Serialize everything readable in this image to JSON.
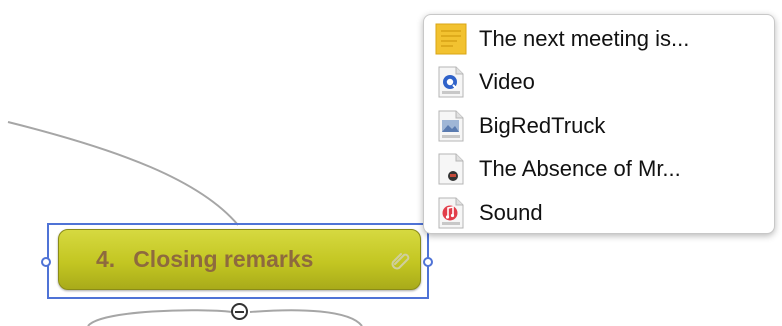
{
  "topic": {
    "number": "4.",
    "title": "Closing remarks",
    "attachment_icon": "paperclip-icon",
    "fill_color": "#c8cb28",
    "text_color": "#8e6a3e",
    "selection_color": "#4f73d6"
  },
  "collapse_toggle": {
    "icon": "minus-circle-icon"
  },
  "attachments_popup": {
    "items": [
      {
        "label": "The next meeting is...",
        "icon": "note-icon"
      },
      {
        "label": "Video",
        "icon": "video-file-icon"
      },
      {
        "label": "BigRedTruck",
        "icon": "png-file-icon"
      },
      {
        "label": "The Absence of Mr...",
        "icon": "document-file-icon"
      },
      {
        "label": "Sound",
        "icon": "audio-file-icon"
      }
    ]
  }
}
